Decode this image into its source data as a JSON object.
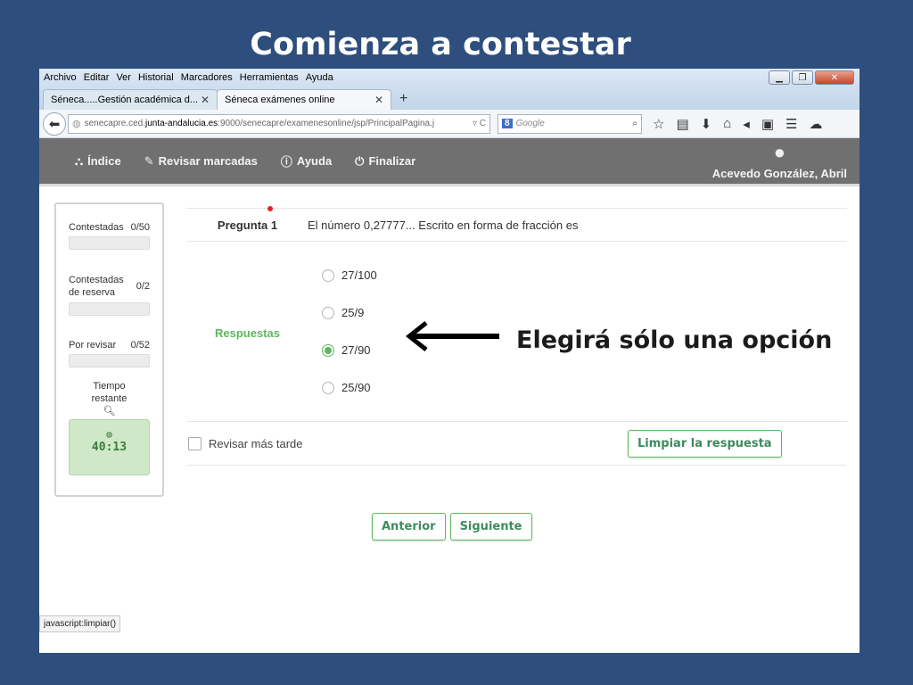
{
  "slide": {
    "title": "Comienza a contestar",
    "annotation": "Elegirá sólo una opción"
  },
  "browser": {
    "menu": [
      "Archivo",
      "Editar",
      "Ver",
      "Historial",
      "Marcadores",
      "Herramientas",
      "Ayuda"
    ],
    "tabs": [
      {
        "label": "Séneca.....Gestión académica d...",
        "active": false
      },
      {
        "label": "Séneca exámenes online",
        "active": true
      }
    ],
    "url": {
      "prefix": "senecapre.ced.",
      "domain": "junta-andalucia.es",
      "path": ":9000/senecapre/examenesonline/jsp/PrincipalPagina.j"
    },
    "search_placeholder": "Google",
    "status_text": "javascript:limpiar()"
  },
  "app": {
    "nav": [
      {
        "icon": "sitemap-icon",
        "label": "Índice"
      },
      {
        "icon": "pencil-icon",
        "label": "Revisar marcadas"
      },
      {
        "icon": "info-icon",
        "label": "Ayuda"
      },
      {
        "icon": "power-icon",
        "label": "Finalizar"
      }
    ],
    "user_name": "Acevedo González, Abril"
  },
  "sidebar": {
    "contestadas_label": "Contestadas",
    "contestadas_value": "0/50",
    "reserva_label": "Contestadas de reserva",
    "reserva_value": "0/2",
    "revisar_label": "Por revisar",
    "revisar_value": "0/52",
    "timer_label": "Tiempo restante",
    "timer_value": "40:13"
  },
  "question": {
    "label": "Pregunta 1",
    "text": "El número 0,27777... Escrito en forma de fracción es",
    "responses_label": "Respuestas",
    "options": [
      {
        "label": "27/100",
        "selected": false
      },
      {
        "label": "25/9",
        "selected": false
      },
      {
        "label": "27/90",
        "selected": true
      },
      {
        "label": "25/90",
        "selected": false
      }
    ],
    "review_later_label": "Revisar más tarde",
    "clear_button": "Limpiar la respuesta"
  },
  "pager": {
    "prev": "Anterior",
    "next": "Siguiente"
  },
  "colors": {
    "background": "#2e4e7d",
    "header": "#707070",
    "accent_green": "#5cb85c",
    "timer_bg": "#cfe8c8"
  }
}
